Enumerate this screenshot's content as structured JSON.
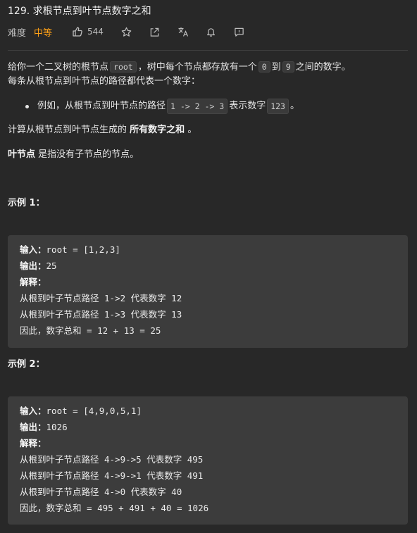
{
  "problem": {
    "title": "129. 求根节点到叶节点数字之和",
    "difficulty_label": "难度",
    "difficulty": "中等",
    "likes": "544"
  },
  "description": {
    "p1_a": "给你一个二叉树的根节点",
    "p1_code": "root",
    "p1_b": "，树中每个节点都存放有一个",
    "p1_code2": "0",
    "p1_c": "到",
    "p1_code3": "9",
    "p1_d": "之间的数字。",
    "p2": "每条从根节点到叶节点的路径都代表一个数字：",
    "bullet_a": "例如，从根节点到叶节点的路径",
    "bullet_code": "1 -> 2 -> 3",
    "bullet_b": "表示数字",
    "bullet_code2": "123",
    "bullet_c": "。",
    "p3_a": "计算从根节点到叶节点生成的",
    "p3_strong": "所有数字之和",
    "p3_b": "。",
    "p4_strong": "叶节点",
    "p4_b": "是指没有子节点的节点。"
  },
  "examples": [
    {
      "title": "示例 1：",
      "input_label": "输入：",
      "input": "root = [1,2,3]",
      "output_label": "输出：",
      "output": "25",
      "explain_label": "解释：",
      "lines": [
        "从根到叶子节点路径 1->2 代表数字 12",
        "从根到叶子节点路径 1->3 代表数字 13",
        "因此，数字总和 = 12 + 13 = 25"
      ]
    },
    {
      "title": "示例 2：",
      "input_label": "输入：",
      "input": "root = [4,9,0,5,1]",
      "output_label": "输出：",
      "output": "1026",
      "explain_label": "解释：",
      "lines": [
        "从根到叶子节点路径 4->9->5 代表数字 495",
        "从根到叶子节点路径 4->9->1 代表数字 491",
        "从根到叶子节点路径 4->0 代表数字 40",
        "因此，数字总和 = 495 + 491 + 40 = 1026"
      ]
    }
  ],
  "colors": {
    "background": "#282828",
    "difficulty_medium": "#ffa116",
    "code_block_bg": "#3c3c3c"
  },
  "icons": [
    "thumbs-up-icon",
    "star-icon",
    "share-icon",
    "translate-icon",
    "bell-icon",
    "feedback-icon"
  ]
}
